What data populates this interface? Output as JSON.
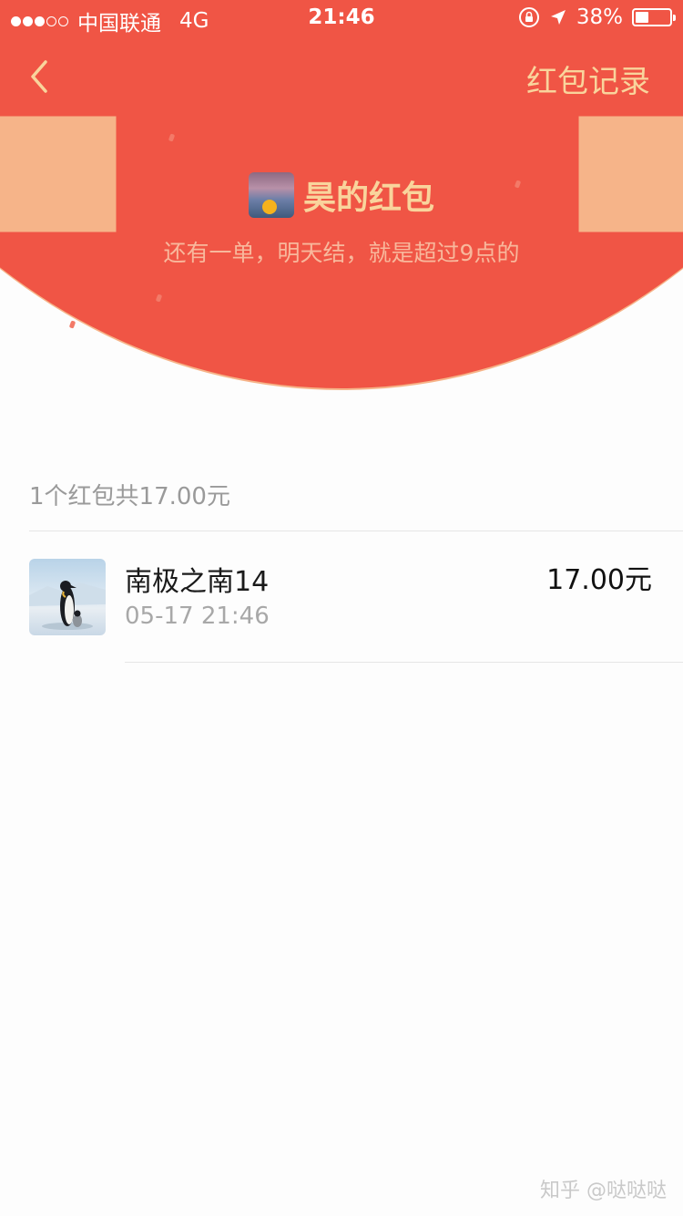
{
  "status_bar": {
    "carrier": "中国联通",
    "network": "4G",
    "time": "21:46",
    "battery_percent": "38%",
    "battery_level": 0.38,
    "signal_bars": 3,
    "signal_total": 5
  },
  "nav": {
    "right_label": "红包记录"
  },
  "header": {
    "sender_name": "昊的红包",
    "greeting": "还有一单，明天结，就是超过9点的"
  },
  "summary": "1个红包共17.00元",
  "records": [
    {
      "name": "南极之南14",
      "time": "05-17 21:46",
      "amount": "17.00元"
    }
  ],
  "watermark": "知乎 @哒哒哒",
  "colors": {
    "header_red": "#f05545",
    "gold_text": "#f9d49c",
    "page_bg": "#fdfdfd"
  },
  "icons": {
    "back": "chevron-left-icon",
    "orientation_lock": "orientation-lock-icon",
    "location": "location-arrow-icon",
    "battery": "battery-icon"
  }
}
